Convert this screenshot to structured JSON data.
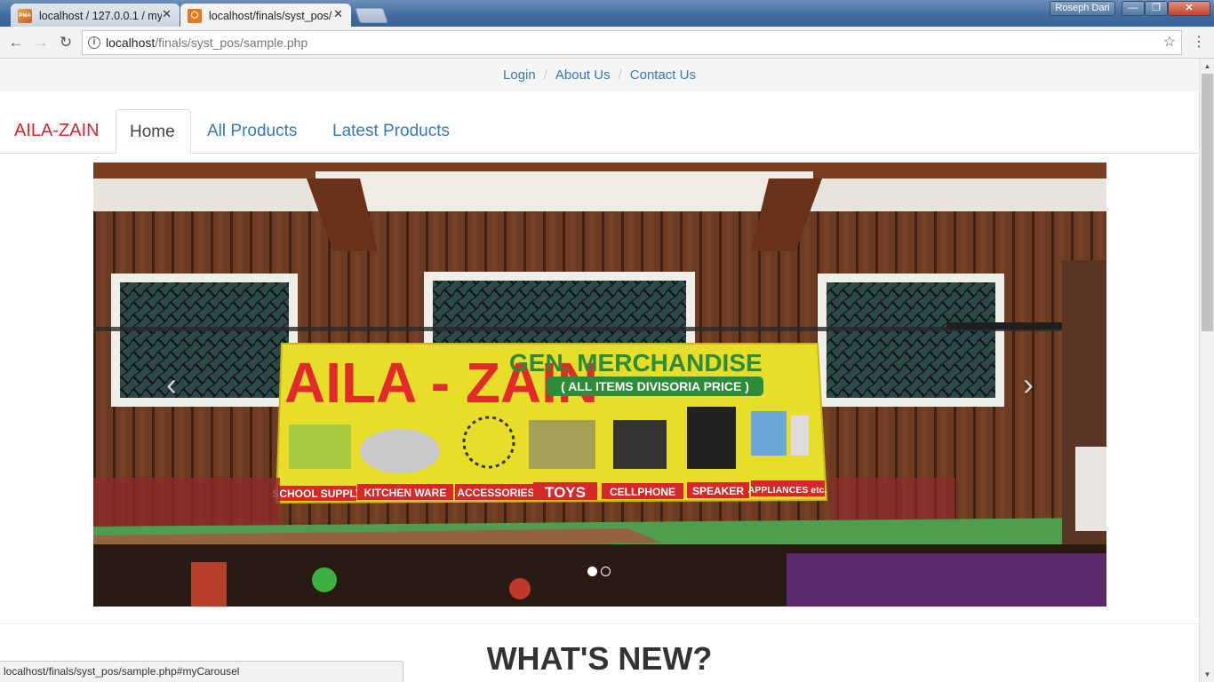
{
  "browser": {
    "tabs": [
      {
        "title": "localhost / 127.0.0.1 / my",
        "active": false
      },
      {
        "title": "localhost/finals/syst_pos/",
        "active": true
      }
    ],
    "user_badge": "Roseph Dari",
    "url_host": "localhost",
    "url_path": "/finals/syst_pos/sample.php",
    "status_url": "localhost/finals/syst_pos/sample.php#myCarousel"
  },
  "top_links": {
    "login": "Login",
    "about": "About Us",
    "contact": "Contact Us"
  },
  "nav": {
    "brand": "AILA-ZAIN",
    "home": "Home",
    "all_products": "All Products",
    "latest_products": "Latest Products"
  },
  "carousel": {
    "sign_title": "AILA - ZAIN",
    "sign_subtitle": "GEN. MERCHANDISE",
    "sign_tagline": "( ALL ITEMS DIVISORIA PRICE )",
    "categories": [
      "SCHOOL SUPPLY",
      "KITCHEN WARE",
      "ACCESSORIES",
      "TOYS",
      "CELLPHONE",
      "SPEAKER",
      "APPLIANCES etc."
    ],
    "slide_count": 2,
    "active_slide": 1
  },
  "section": {
    "heading": "WHAT'S NEW?"
  },
  "colors": {
    "brand_red": "#d9232d",
    "link_blue": "#337ab7",
    "sign_yellow": "#e8de2a",
    "sign_green": "#2e8b3a"
  }
}
